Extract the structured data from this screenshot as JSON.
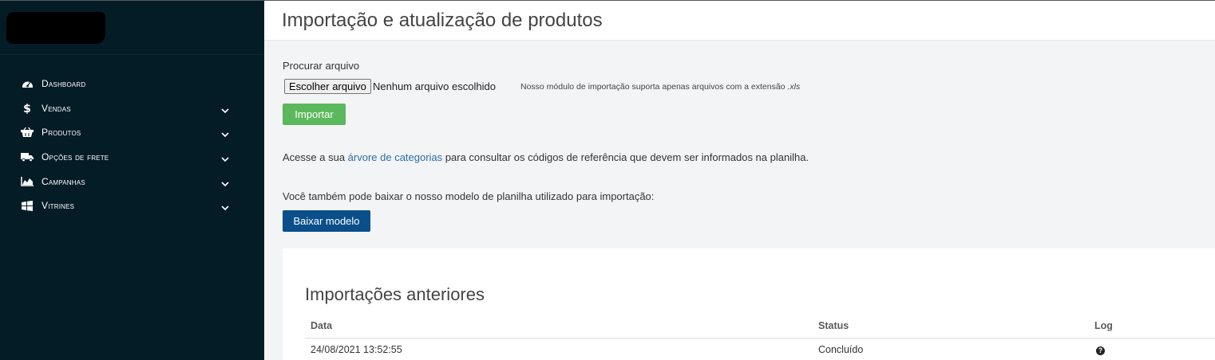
{
  "sidebar": {
    "items": [
      {
        "label": "Dashboard",
        "icon": "dashboard-icon",
        "has_chevron": false
      },
      {
        "label": "Vendas",
        "icon": "dollar-icon",
        "has_chevron": true
      },
      {
        "label": "Produtos",
        "icon": "basket-icon",
        "has_chevron": true
      },
      {
        "label": "Opções de frete",
        "icon": "truck-icon",
        "has_chevron": true
      },
      {
        "label": "Campanhas",
        "icon": "area-chart-icon",
        "has_chevron": true
      },
      {
        "label": "Vitrines",
        "icon": "windows-icon",
        "has_chevron": true
      }
    ]
  },
  "header": {
    "title": "Importação e atualização de produtos"
  },
  "import_form": {
    "file_label": "Procurar arquivo",
    "choose_button": "Escolher arquivo",
    "no_file": "Nenhum arquivo escolhido",
    "hint": "Nosso módulo de importação suporta apenas arquivos com a extensão",
    "hint_ext": ".xls",
    "import_button": "Importar"
  },
  "info": {
    "tree_prefix": "Acesse a sua ",
    "tree_link": "árvore de categorias",
    "tree_suffix": " para consultar os códigos de referência que devem ser informados na planilha.",
    "model_text": "Você também pode baixar o nosso modelo de planilha utilizado para importação:",
    "download_button": "Baixar modelo"
  },
  "previous": {
    "title": "Importações anteriores",
    "columns": [
      "Data",
      "Status",
      "Log"
    ],
    "rows": [
      {
        "date": "24/08/2021 13:52:55",
        "status": "Concluído",
        "log_icon": "question-circle-icon"
      }
    ]
  },
  "colors": {
    "sidebar_bg": "#041c26",
    "import_green": "#5cb85c",
    "download_blue": "#0b4f8a",
    "link_blue": "#2a6fa8"
  }
}
